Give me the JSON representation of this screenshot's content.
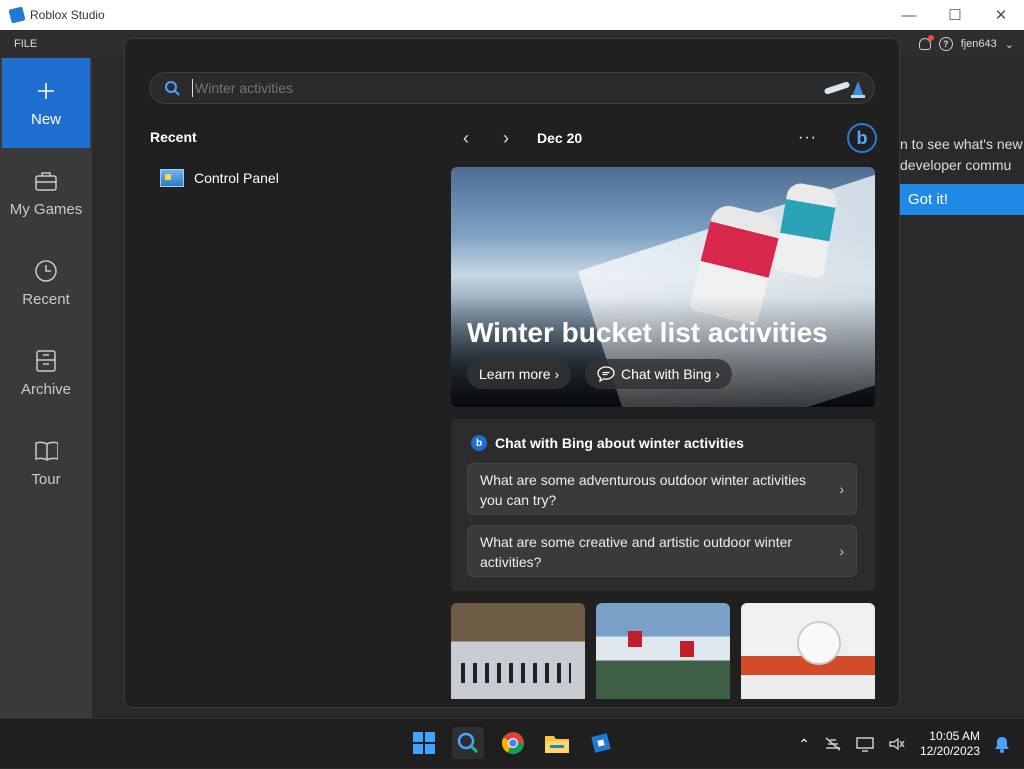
{
  "window": {
    "title": "Roblox Studio",
    "minimize": "—",
    "maximize": "☐",
    "close": "✕"
  },
  "menubar": {
    "file": "FILE",
    "username": "fjen643",
    "help": "?",
    "dropdown": "⌄"
  },
  "sidebar": {
    "items": [
      {
        "label": "New",
        "icon": "plus-icon"
      },
      {
        "label": "My Games",
        "icon": "briefcase-icon"
      },
      {
        "label": "Recent",
        "icon": "clock-icon"
      },
      {
        "label": "Archive",
        "icon": "archive-icon"
      },
      {
        "label": "Tour",
        "icon": "book-icon"
      }
    ]
  },
  "studio_bg": {
    "line1": "n to see what's new",
    "line2": "developer commu",
    "got_it": "Got it!"
  },
  "search": {
    "value": "",
    "placeholder": "Winter activities"
  },
  "recent": {
    "title": "Recent",
    "items": [
      {
        "label": "Control Panel",
        "icon": "control-panel-icon"
      }
    ]
  },
  "nav": {
    "prev": "‹",
    "next": "›",
    "date": "Dec 20",
    "more": "···",
    "bing": "b"
  },
  "hero": {
    "title": "Winter bucket list activities",
    "learn_more": "Learn more ›",
    "chat_with_bing": "Chat with Bing ›"
  },
  "chat": {
    "heading": "Chat with Bing about winter activities",
    "questions": [
      "What are some adventurous outdoor winter activities you can try?",
      "What are some creative and artistic outdoor winter activities?"
    ],
    "chevron": "›"
  },
  "taskbar": {
    "tray_chevron": "⌃",
    "time": "10:05 AM",
    "date": "12/20/2023"
  },
  "colors": {
    "accent": "#1e6fcf",
    "got_it": "#1e8ae6",
    "flyout_bg": "#202020"
  }
}
